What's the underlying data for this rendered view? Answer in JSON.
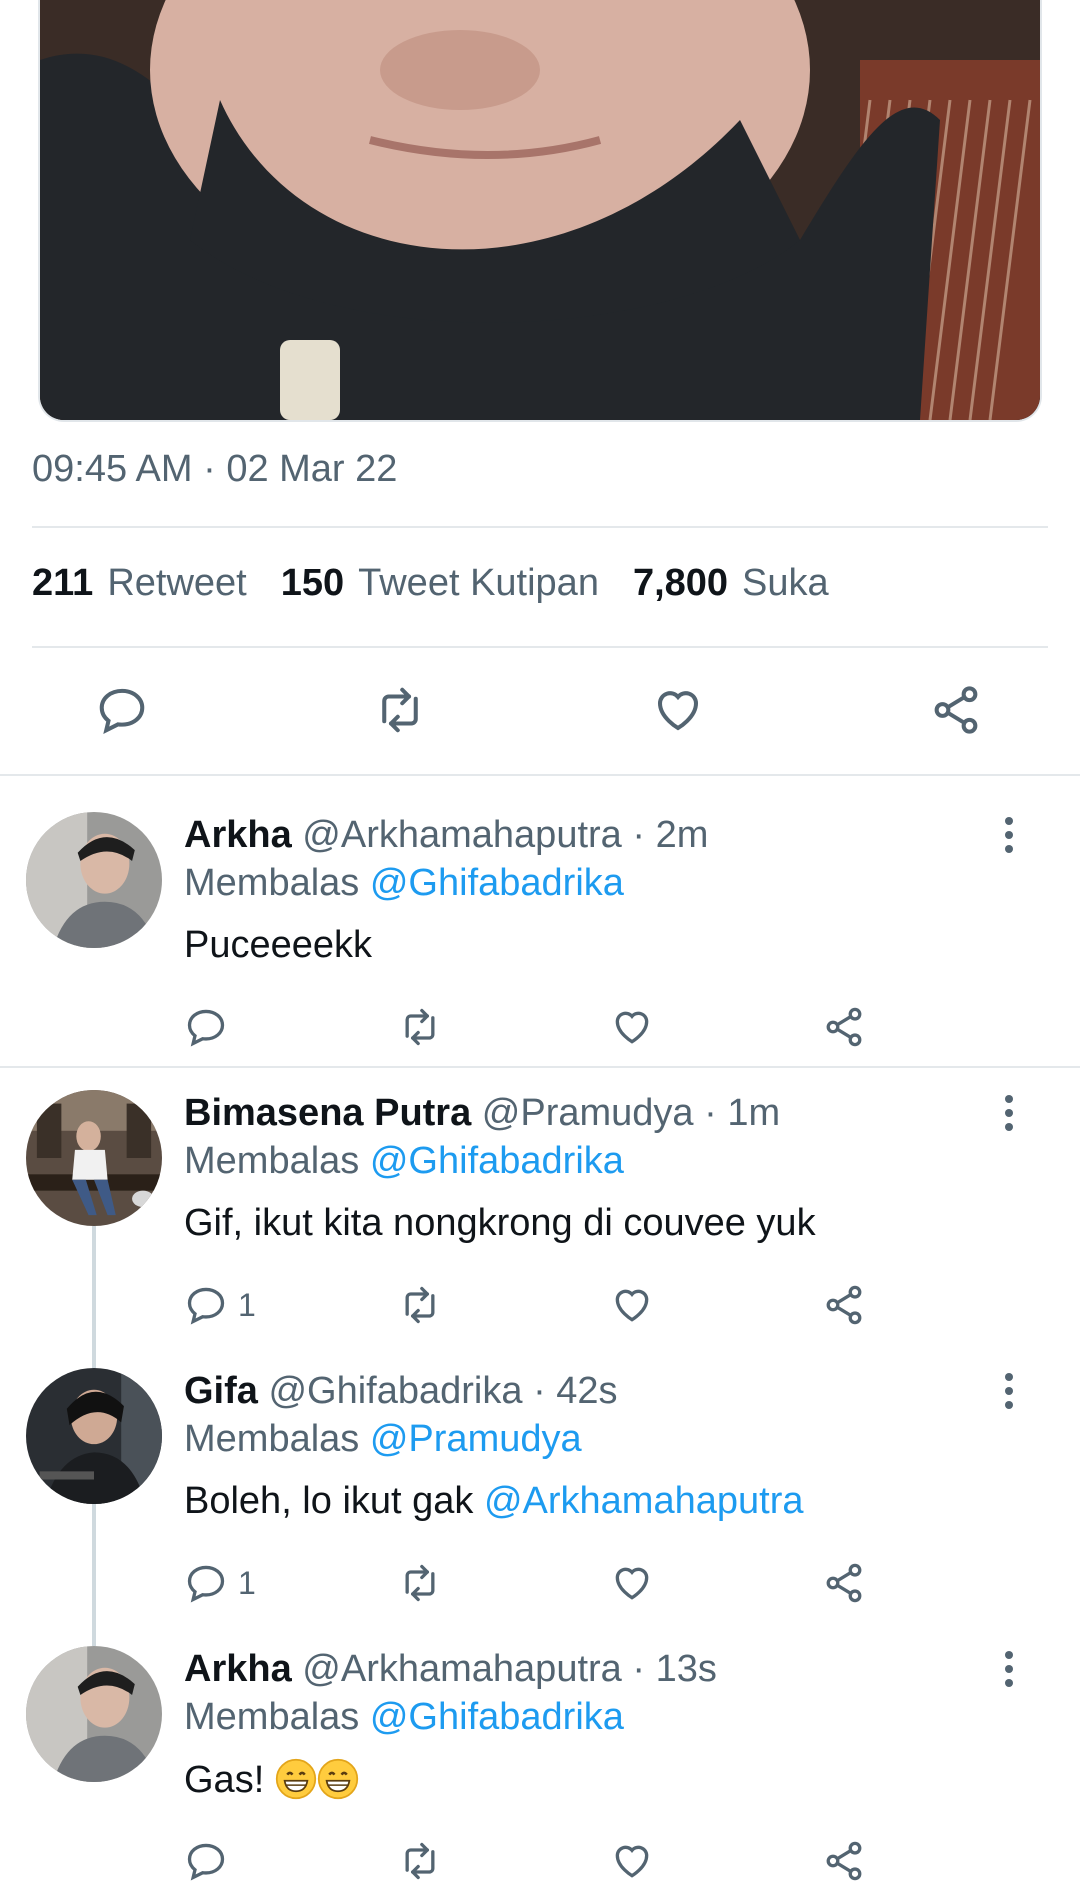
{
  "tweet": {
    "timestamp": "09:45 AM · 02 Mar 22",
    "stats": [
      {
        "count": "211",
        "label": "Retweet"
      },
      {
        "count": "150",
        "label": "Tweet Kutipan"
      },
      {
        "count": "7,800",
        "label": "Suka"
      }
    ]
  },
  "colors": {
    "accent": "#1d9bf0",
    "muted": "#536471",
    "text": "#0f1419"
  },
  "replies": [
    {
      "name": "Arkha",
      "handle": "@Arkhamahaputra",
      "time": "· 2m",
      "reply_prefix": "Membalas",
      "reply_to": "@Ghifabadrika",
      "text": "Puceeeekk",
      "reply_count": ""
    },
    {
      "name": "Bimasena Putra",
      "handle": "@Pramudya",
      "time": "· 1m",
      "reply_prefix": "Membalas",
      "reply_to": "@Ghifabadrika",
      "text": "Gif, ikut kita nongkrong di couvee yuk",
      "reply_count": "1"
    },
    {
      "name": "Gifa",
      "handle": "@Ghifabadrika",
      "time": "· 42s",
      "reply_prefix": "Membalas",
      "reply_to": "@Pramudya",
      "text": "Boleh, lo ikut gak ",
      "mention": "@Arkhamahaputra",
      "reply_count": "1"
    },
    {
      "name": "Arkha",
      "handle": "@Arkhamahaputra",
      "time": "· 13s",
      "reply_prefix": "Membalas",
      "reply_to": "@Ghifabadrika",
      "text": "Gas! ",
      "reply_count": ""
    }
  ]
}
